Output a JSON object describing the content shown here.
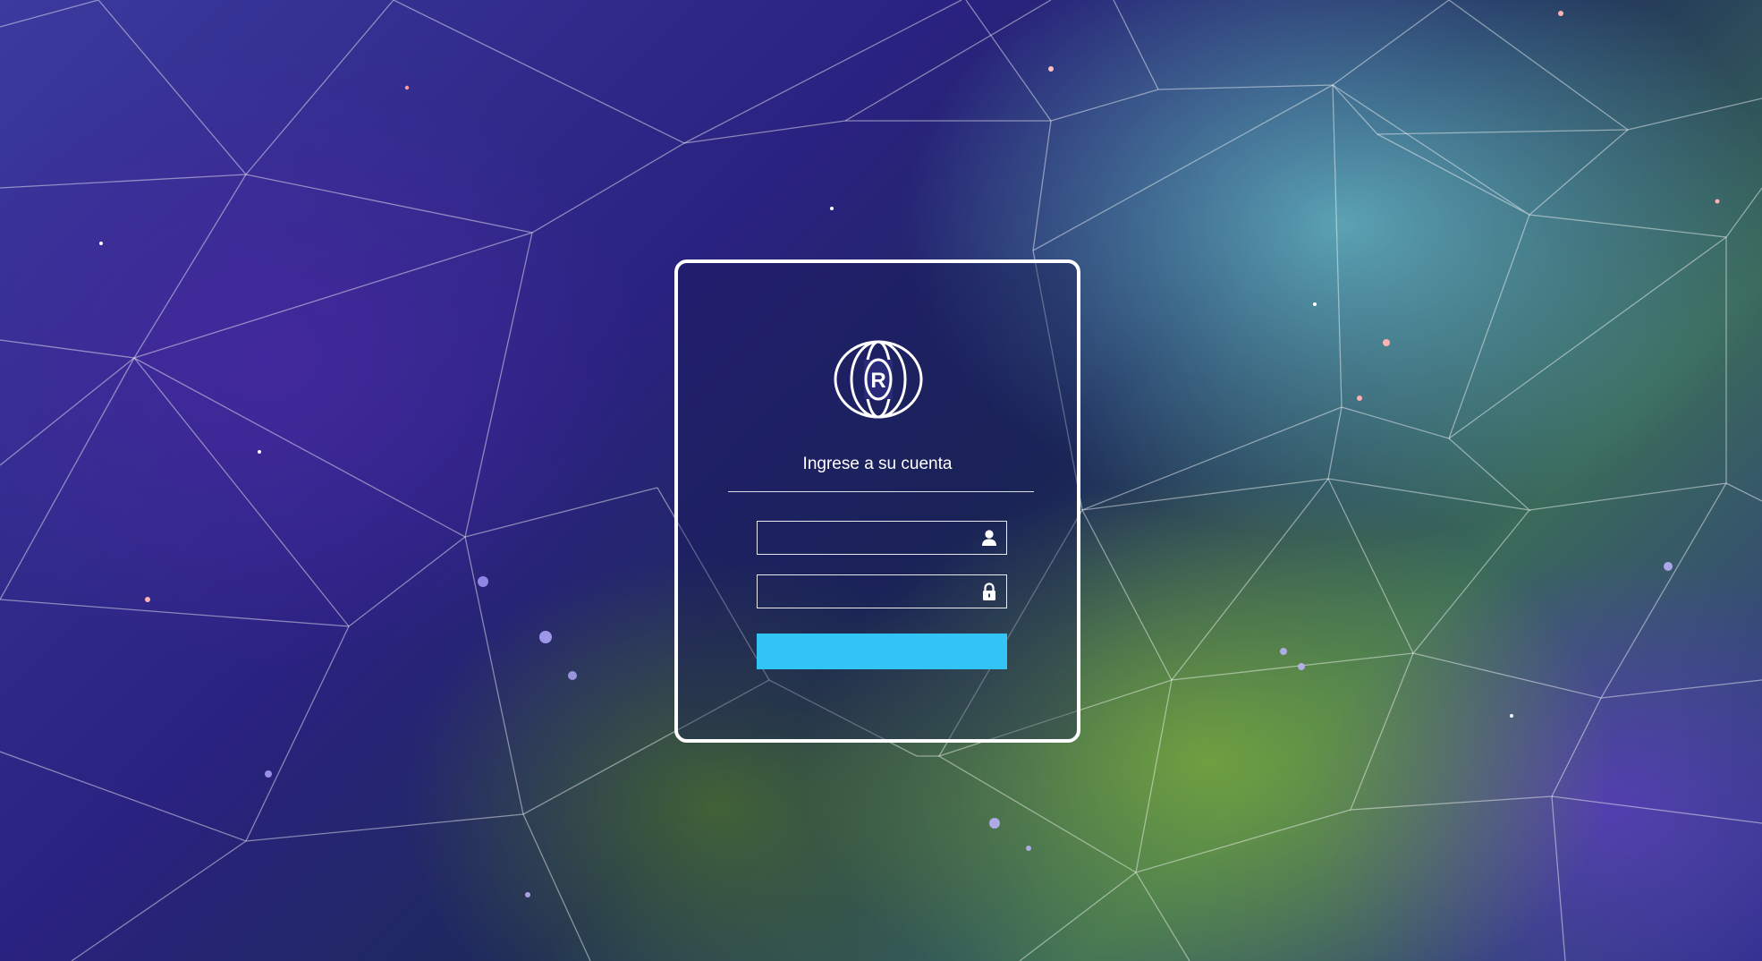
{
  "login": {
    "title": "Ingrese a su cuenta",
    "username_value": "",
    "password_value": "",
    "submit_label": ""
  },
  "logo": {
    "letter": "R"
  },
  "icons": {
    "username": "user-icon",
    "password": "lock-icon"
  },
  "colors": {
    "submit_button": "#33c4f6",
    "card_border": "#ffffff",
    "text": "#ffffff"
  }
}
